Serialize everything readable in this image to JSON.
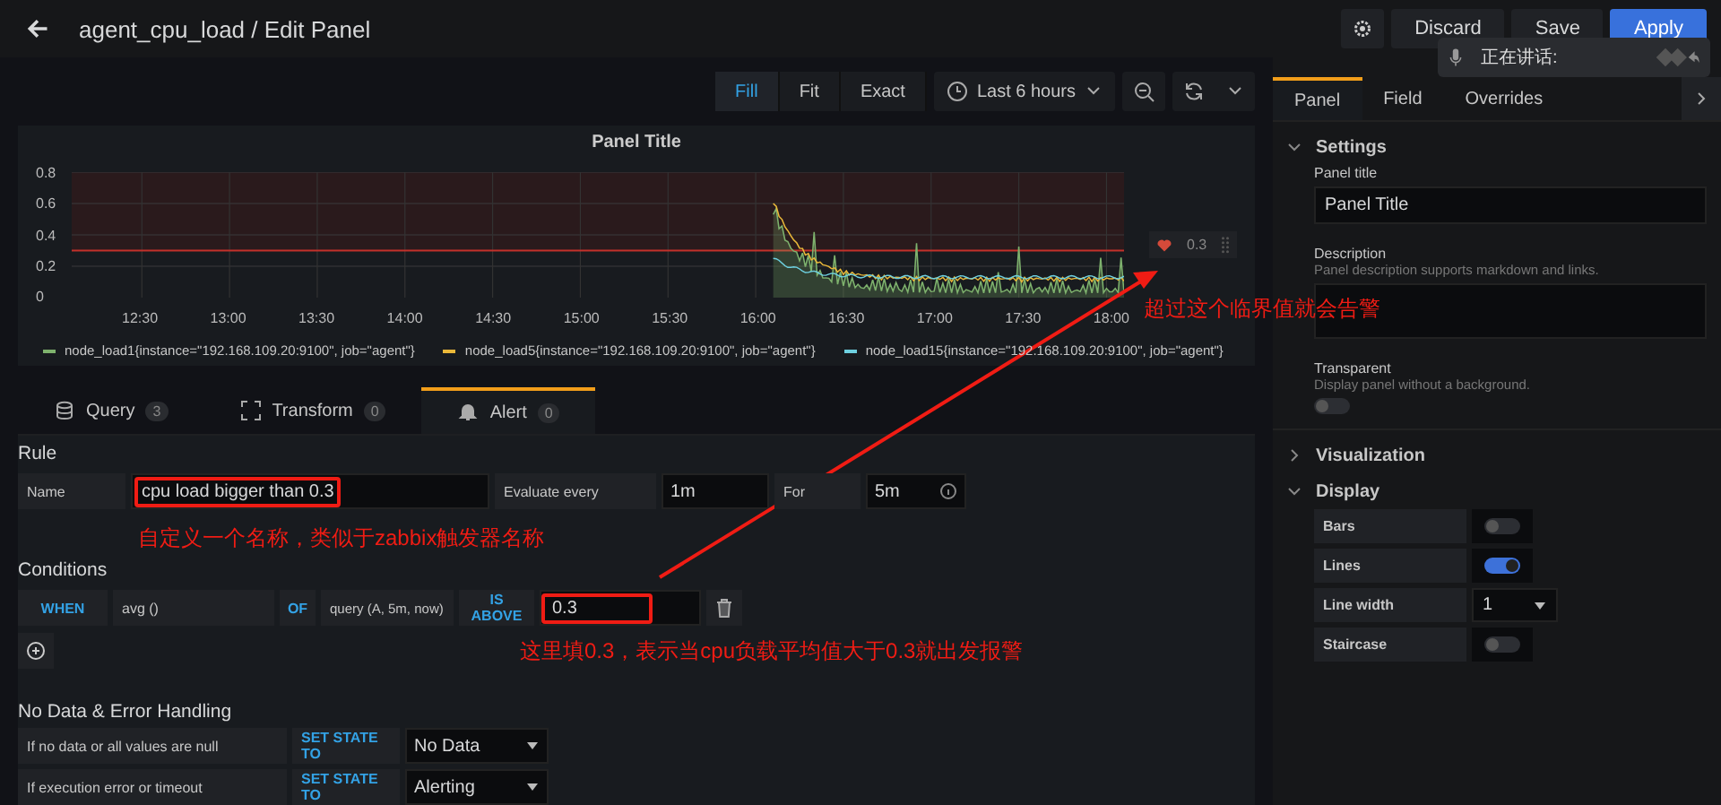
{
  "header": {
    "title": "agent_cpu_load / Edit Panel",
    "buttons": [
      {
        "kind": "icon"
      },
      {
        "kind": "secondary",
        "label": "Discard"
      },
      {
        "kind": "secondary",
        "label": "Save"
      },
      {
        "kind": "primary",
        "label": "Apply"
      }
    ]
  },
  "voice_popup": {
    "text": "正在讲话:"
  },
  "toolbar": {
    "view_modes": [
      {
        "label": "Fill",
        "selected": true
      },
      {
        "label": "Fit",
        "selected": false
      },
      {
        "label": "Exact",
        "selected": false
      }
    ],
    "time_range": "Last 6 hours"
  },
  "panel": {
    "title": "Panel Title",
    "y_ticks": [
      "0.8",
      "0.6",
      "0.4",
      "0.2",
      "0"
    ],
    "x_ticks": [
      "12:30",
      "13:00",
      "13:30",
      "14:00",
      "14:30",
      "15:00",
      "15:30",
      "16:00",
      "16:30",
      "17:00",
      "17:30",
      "18:00"
    ],
    "legend": [
      {
        "label": "node_load1{instance=\"192.168.109.20:9100\", job=\"agent\"}",
        "color": "#7eb26d"
      },
      {
        "label": "node_load5{instance=\"192.168.109.20:9100\", job=\"agent\"}",
        "color": "#eab839"
      },
      {
        "label": "node_load15{instance=\"192.168.109.20:9100\", job=\"agent\"}",
        "color": "#6ed0e0"
      }
    ],
    "threshold": "0.3"
  },
  "query_tabs": [
    {
      "kind": "query",
      "label": "Query",
      "count": "3",
      "selected": false
    },
    {
      "kind": "transform",
      "label": "Transform",
      "count": "0",
      "selected": false
    },
    {
      "kind": "alert",
      "label": "Alert",
      "count": "0",
      "selected": true
    }
  ],
  "rule": {
    "heading": "Rule",
    "name_label": "Name",
    "name_value": "cpu load bigger than 0.3",
    "evaluate_label": "Evaluate every",
    "evaluate_value": "1m",
    "for_label": "For",
    "for_value": "5m"
  },
  "conditions": {
    "heading": "Conditions",
    "when": "WHEN",
    "reducer": "avg ()",
    "of": "OF",
    "query": "query (A, 5m, now)",
    "evaluator": "IS ABOVE",
    "threshold": "0.3"
  },
  "no_data": {
    "heading": "No Data & Error Handling",
    "rows": [
      {
        "label": "If no data or all values are null",
        "action": "SET STATE TO",
        "value": "No Data"
      },
      {
        "label": "If execution error or timeout",
        "action": "SET STATE TO",
        "value": "Alerting"
      }
    ]
  },
  "annotations": [
    {
      "text": "超过这个临界值就会告警"
    },
    {
      "text": "自定义一个名称，类似于zabbix触发器名称"
    },
    {
      "text": "这里填0.3，表示当cpu负载平均值大于0.3就出发报警"
    }
  ],
  "sidebar": {
    "tabs": [
      {
        "label": "Panel",
        "selected": true
      },
      {
        "label": "Field",
        "selected": false
      },
      {
        "label": "Overrides",
        "selected": false
      }
    ],
    "settings": {
      "heading": "Settings",
      "expanded": true,
      "title_label": "Panel title",
      "title_value": "Panel Title",
      "description_label": "Description",
      "description_hint": "Panel description supports markdown and links.",
      "transparent_label": "Transparent",
      "transparent_hint": "Display panel without a background.",
      "transparent": false
    },
    "visualization": {
      "heading": "Visualization",
      "expanded": false
    },
    "display": {
      "heading": "Display",
      "expanded": true,
      "options": [
        {
          "kind": "toggle",
          "label": "Bars",
          "on": false
        },
        {
          "kind": "toggle",
          "label": "Lines",
          "on": true
        },
        {
          "kind": "select",
          "label": "Line width",
          "value": "1"
        },
        {
          "kind": "toggle",
          "label": "Staircase",
          "on": false
        }
      ]
    }
  }
}
